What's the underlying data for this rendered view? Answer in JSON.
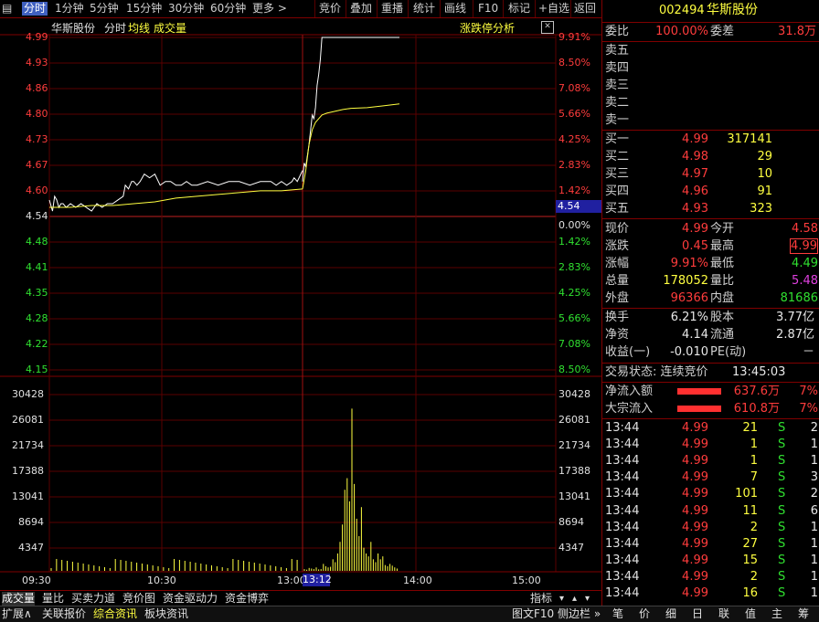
{
  "toolbar": {
    "tabs": [
      "分时",
      "1分钟",
      "5分钟",
      "15分钟",
      "30分钟",
      "60分钟",
      "更多 >"
    ],
    "buttons": [
      "竞价",
      "叠加",
      "重播",
      "统计",
      "画线",
      "F10",
      "标记",
      "+自选",
      "返回"
    ]
  },
  "chart": {
    "stock_name": "华斯股份",
    "mode_label": "分时",
    "avg_label": "均线",
    "vol_label": "成交量",
    "analysis_button": "涨跌停分析",
    "current_price_tag": "4.54",
    "cursor_time": "13:12",
    "time_ticks": [
      "09:30",
      "10:30",
      "13:00",
      "14:00",
      "15:00"
    ]
  },
  "chart_data": {
    "type": "line",
    "price_ticks_left": [
      "4.99",
      "4.93",
      "4.86",
      "4.80",
      "4.73",
      "4.67",
      "4.60",
      "4.54",
      "4.48",
      "4.41",
      "4.35",
      "4.28",
      "4.22",
      "4.15"
    ],
    "pct_ticks_right": [
      "9.91%",
      "8.50%",
      "7.08%",
      "5.66%",
      "4.25%",
      "2.83%",
      "1.42%",
      "0.00%",
      "1.42%",
      "2.83%",
      "4.25%",
      "5.66%",
      "7.08%",
      "8.50%"
    ],
    "volume_ticks": [
      "30428",
      "26081",
      "21734",
      "17388",
      "13041",
      "8694",
      "4347"
    ],
    "prev_close": 4.54,
    "ylim": [
      4.09,
      4.99
    ],
    "series": [
      {
        "name": "分时",
        "color": "#ffffff",
        "x": [
          0,
          3,
          5,
          7,
          9,
          11,
          13,
          16,
          20,
          25,
          30,
          35,
          40,
          45,
          50,
          55,
          60,
          65,
          70,
          72,
          75,
          78,
          80,
          83,
          86,
          90,
          95,
          100,
          105,
          110,
          115,
          120,
          125,
          130,
          135,
          140,
          150,
          160,
          170,
          180,
          190,
          200,
          210,
          215,
          220,
          225,
          230,
          232,
          235,
          240
        ],
        "y": [
          4.55,
          4.52,
          4.56,
          4.55,
          4.53,
          4.54,
          4.54,
          4.53,
          4.54,
          4.53,
          4.54,
          4.53,
          4.52,
          4.54,
          4.53,
          4.54,
          4.54,
          4.55,
          4.56,
          4.59,
          4.58,
          4.6,
          4.6,
          4.59,
          4.6,
          4.62,
          4.61,
          4.62,
          4.59,
          4.6,
          4.6,
          4.59,
          4.59,
          4.6,
          4.59,
          4.59,
          4.6,
          4.59,
          4.6,
          4.6,
          4.59,
          4.6,
          4.6,
          4.59,
          4.6,
          4.59,
          4.6,
          4.61,
          4.6,
          4.63
        ]
      },
      {
        "name": "均线",
        "color": "#ffff40",
        "x": [
          0,
          20,
          40,
          60,
          80,
          100,
          120,
          140,
          160,
          180,
          200,
          220,
          240
        ],
        "y": [
          4.53,
          4.53,
          4.535,
          4.535,
          4.54,
          4.545,
          4.555,
          4.56,
          4.565,
          4.57,
          4.575,
          4.575,
          4.58
        ]
      }
    ],
    "afternoon": {
      "price_x": [
        0,
        2,
        4,
        6,
        8,
        10,
        12,
        14,
        16,
        18,
        20,
        22,
        24,
        26,
        28,
        30,
        32,
        34,
        40,
        60,
        80,
        100,
        120
      ],
      "price_y": [
        4.6,
        4.65,
        4.64,
        4.67,
        4.7,
        4.74,
        4.78,
        4.77,
        4.8,
        4.86,
        4.89,
        4.93,
        4.99,
        4.99,
        4.99,
        4.99,
        4.99,
        4.99,
        4.99,
        4.99,
        4.99,
        4.99,
        4.99
      ],
      "avg_x": [
        0,
        4,
        8,
        12,
        16,
        20,
        24,
        30,
        40,
        50,
        60,
        80,
        100,
        120
      ],
      "avg_y": [
        4.58,
        4.63,
        4.7,
        4.74,
        4.76,
        4.77,
        4.78,
        4.785,
        4.79,
        4.795,
        4.798,
        4.8,
        4.805,
        4.81
      ]
    },
    "volume": [
      300,
      200,
      500,
      400,
      300,
      600,
      250,
      300,
      1200,
      800,
      600,
      700,
      2000,
      1500,
      3000,
      5000,
      8000,
      14000,
      16000,
      12000,
      28000,
      15000,
      9000,
      6000,
      11000,
      4000,
      3000,
      2500,
      5000,
      2000,
      1500,
      3000,
      2000,
      2500,
      1000,
      800,
      1200,
      900,
      600,
      400
    ]
  },
  "quote": {
    "code": "002494",
    "name": "华斯股份",
    "weibi_label": "委比",
    "weibi": "100.00%",
    "weicha_label": "委差",
    "weicha": "31.8万",
    "sells": [
      "卖五",
      "卖四",
      "卖三",
      "卖二",
      "卖一"
    ],
    "buys": [
      {
        "label": "买一",
        "price": "4.99",
        "vol": "317141"
      },
      {
        "label": "买二",
        "price": "4.98",
        "vol": "29"
      },
      {
        "label": "买三",
        "price": "4.97",
        "vol": "10"
      },
      {
        "label": "买四",
        "price": "4.96",
        "vol": "91"
      },
      {
        "label": "买五",
        "price": "4.93",
        "vol": "323"
      }
    ],
    "stats": [
      {
        "l1": "现价",
        "v1": "4.99",
        "l2": "今开",
        "v2": "4.58"
      },
      {
        "l1": "涨跌",
        "v1": "0.45",
        "l2": "最高",
        "v2": "4.99"
      },
      {
        "l1": "涨幅",
        "v1": "9.91%",
        "l2": "最低",
        "v2": "4.49"
      },
      {
        "l1": "总量",
        "v1": "178052",
        "l2": "量比",
        "v2": "5.48"
      },
      {
        "l1": "外盘",
        "v1": "96366",
        "l2": "内盘",
        "v2": "81686"
      }
    ],
    "stats2": [
      {
        "l1": "换手",
        "v1": "6.21%",
        "l2": "股本",
        "v2": "3.77亿"
      },
      {
        "l1": "净资",
        "v1": "4.14",
        "l2": "流通",
        "v2": "2.87亿"
      },
      {
        "l1": "收益(一)",
        "v1": "-0.010",
        "l2": "PE(动)",
        "v2": "－"
      }
    ],
    "trade_state_label": "交易状态: 连续竞价",
    "trade_time": "13:45:03",
    "flows": [
      {
        "label": "净流入额",
        "value": "637.6万",
        "pct": "7%"
      },
      {
        "label": "大宗流入",
        "value": "610.8万",
        "pct": "7%"
      }
    ],
    "ticks": [
      {
        "t": "13:44",
        "p": "4.99",
        "v": "21",
        "s": "S",
        "n": "2"
      },
      {
        "t": "13:44",
        "p": "4.99",
        "v": "1",
        "s": "S",
        "n": "1"
      },
      {
        "t": "13:44",
        "p": "4.99",
        "v": "1",
        "s": "S",
        "n": "1"
      },
      {
        "t": "13:44",
        "p": "4.99",
        "v": "7",
        "s": "S",
        "n": "3"
      },
      {
        "t": "13:44",
        "p": "4.99",
        "v": "101",
        "s": "S",
        "n": "2"
      },
      {
        "t": "13:44",
        "p": "4.99",
        "v": "11",
        "s": "S",
        "n": "6"
      },
      {
        "t": "13:44",
        "p": "4.99",
        "v": "2",
        "s": "S",
        "n": "1"
      },
      {
        "t": "13:44",
        "p": "4.99",
        "v": "27",
        "s": "S",
        "n": "1"
      },
      {
        "t": "13:44",
        "p": "4.99",
        "v": "15",
        "s": "S",
        "n": "1"
      },
      {
        "t": "13:44",
        "p": "4.99",
        "v": "2",
        "s": "S",
        "n": "1"
      },
      {
        "t": "13:44",
        "p": "4.99",
        "v": "16",
        "s": "S",
        "n": "1"
      }
    ]
  },
  "bottom_tabs": [
    "成交量",
    "量比",
    "买卖力道",
    "竞价图",
    "资金驱动力",
    "资金博弈"
  ],
  "bottom_right": "指标",
  "status_bar": {
    "left": [
      "扩展∧",
      "关联报价",
      "综合资讯",
      "板块资讯"
    ],
    "mid": [
      "图文F10",
      "侧边栏 »"
    ],
    "right": [
      "笔",
      "价",
      "细",
      "日",
      "联",
      "值",
      "主",
      "筹"
    ]
  }
}
